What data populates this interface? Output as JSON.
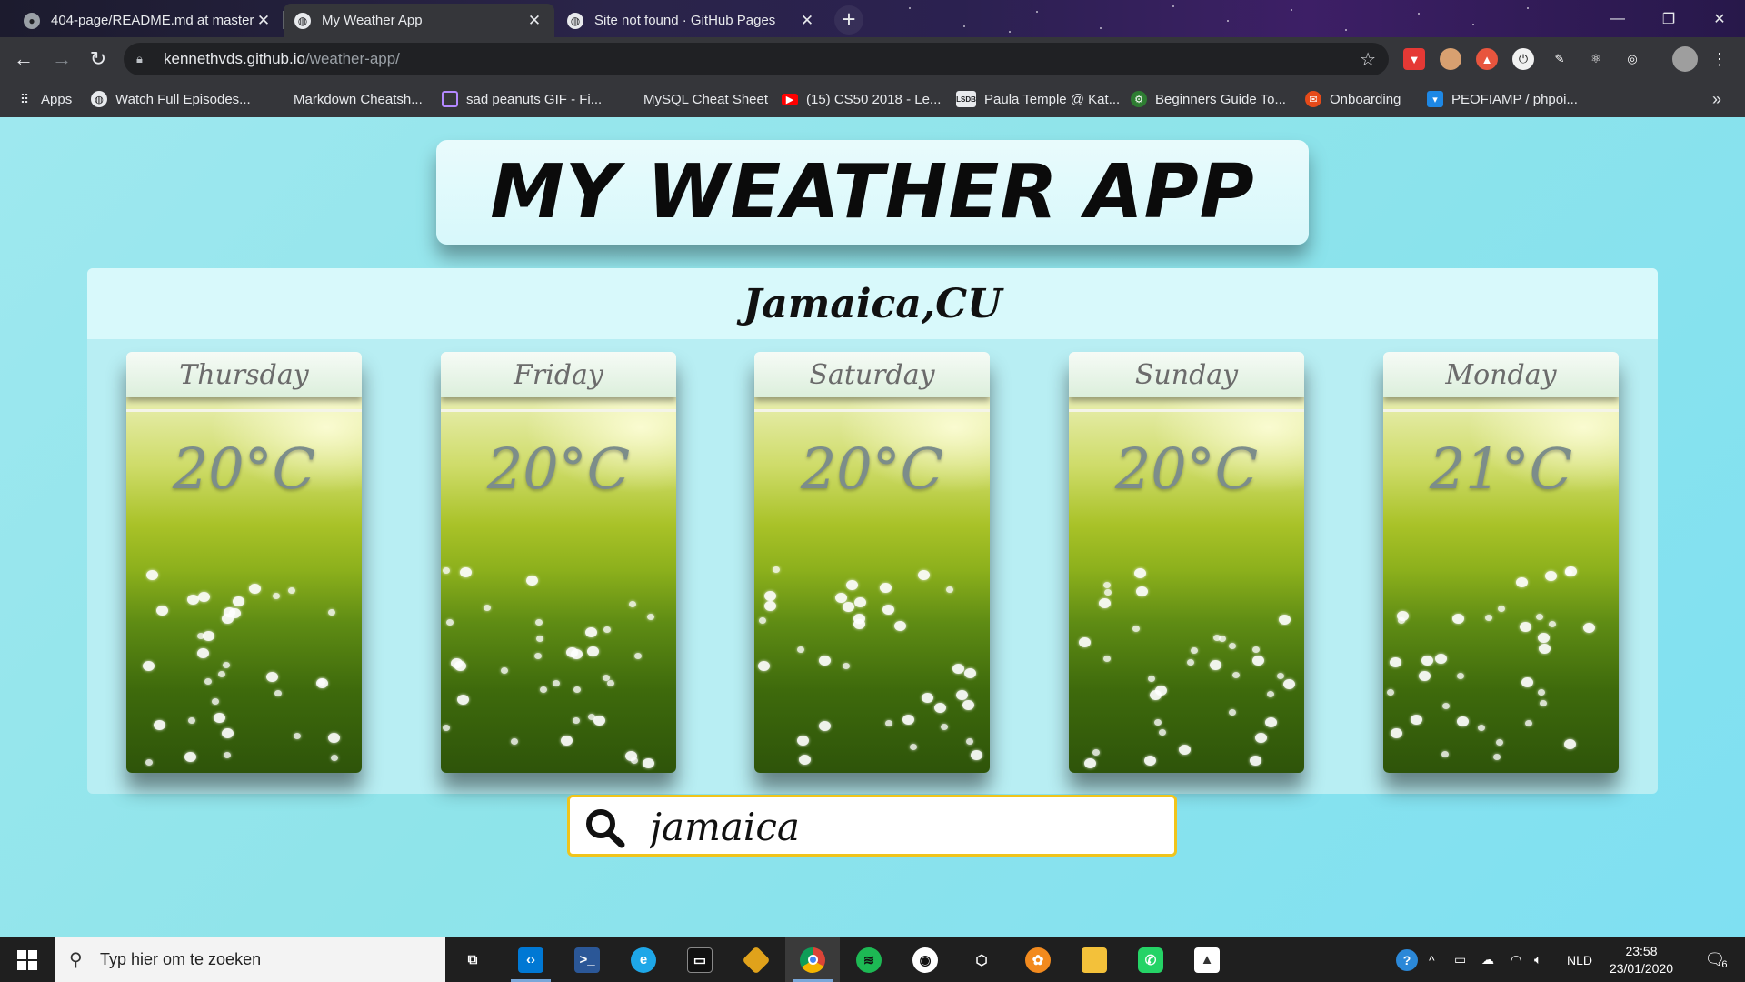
{
  "browser": {
    "tabs": [
      {
        "title": "404-page/README.md at master",
        "active": false,
        "favicon": "github-icon"
      },
      {
        "title": "My Weather App",
        "active": true,
        "favicon": "globe-icon"
      },
      {
        "title": "Site not found · GitHub Pages",
        "active": false,
        "favicon": "globe-icon"
      }
    ],
    "address": {
      "host": "kennethvds.github.io",
      "path": "/weather-app/"
    },
    "bookmarks": [
      {
        "label": "Apps",
        "icon": "apps-grid-icon"
      },
      {
        "label": "Watch Full Episodes...",
        "icon": "globe-icon"
      },
      {
        "label": "Markdown Cheatsh...",
        "icon": ""
      },
      {
        "label": "sad peanuts GIF - Fi...",
        "icon": "document-icon"
      },
      {
        "label": "MySQL Cheat Sheet",
        "icon": ""
      },
      {
        "label": "(15) CS50 2018 - Le...",
        "icon": "youtube-icon"
      },
      {
        "label": "Paula Temple @ Kat...",
        "icon": "lsdb-icon"
      },
      {
        "label": "Beginners Guide To...",
        "icon": "gear-icon"
      },
      {
        "label": "Onboarding",
        "icon": "onboarding-icon"
      },
      {
        "label": "PEOFIAMP / phpoi...",
        "icon": "bookmark-icon"
      }
    ],
    "overflow_label": "»"
  },
  "app": {
    "title": "MY WEATHER APP",
    "city": "Jamaica,CU",
    "forecast": [
      {
        "day": "Thursday",
        "temp": "20°C"
      },
      {
        "day": "Friday",
        "temp": "20°C"
      },
      {
        "day": "Saturday",
        "temp": "20°C"
      },
      {
        "day": "Sunday",
        "temp": "20°C"
      },
      {
        "day": "Monday",
        "temp": "21°C"
      }
    ],
    "search": {
      "value": "jamaica"
    }
  },
  "taskbar": {
    "search_placeholder": "Typ hier om te zoeken",
    "language": "NLD",
    "time": "23:58",
    "date": "23/01/2020",
    "notifications": "6"
  }
}
